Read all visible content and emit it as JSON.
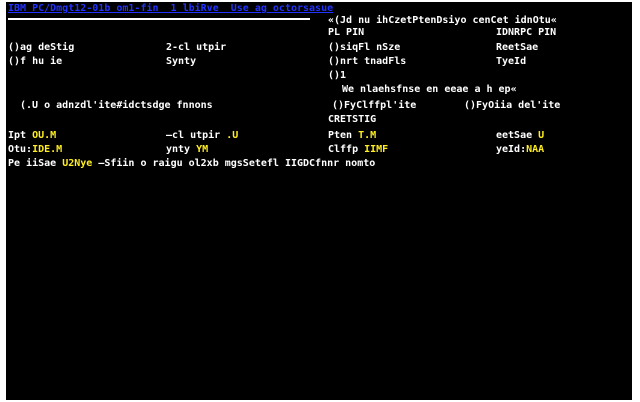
{
  "colors": {
    "background": "#000000",
    "text": "#ffffff",
    "title": "#2233ff",
    "value": "#ffee22"
  },
  "title_bar": "IBM PC/Dmgt12-01b om1-fin  1 lbiRve  Use ag octorsasue",
  "right_panel": {
    "heading": "«(Jd nu ihCzetPtenDsiyo cenCet idnOtu«",
    "line1_left": "PL PIN",
    "line1_right": "IDNRPC PIN",
    "row1_left": "()siqFl nSze",
    "row1_right": "ReetSae",
    "row2_left": "()nrt tnadFls",
    "row2_right": "TyeId",
    "row3_left": "()1",
    "message": "We nlaehsfnse en eeae a h ep«",
    "opt_left": "()FyClffpl'ite",
    "opt_right": "()FyOiia del'ite",
    "section": "CRETSTIG"
  },
  "left_panel": {
    "row1_left": "()ag deStig",
    "row1_right": "2-cl utpir",
    "row2_left": "()f hu ie",
    "row2_right": "Synty",
    "option_text": "(.U o adnzdl'ite#idctsdge fnnons"
  },
  "fields": {
    "ipt_label": "Ipt ",
    "ipt_value": "OU.M",
    "cl_label": "—cl utpir ",
    "cl_value": ".U",
    "ften_label": "Pten ",
    "ften_value": "T.M",
    "eet_label": "eetSae ",
    "eet_value": "U",
    "otu_label": "Otu:",
    "otu_value": "IDE.M",
    "ynty_label": "ynty ",
    "ynty_value": "YM",
    "clffp_label": "Clffp ",
    "clffp_value": "IIMF",
    "yeld_label": "yeId:",
    "yeld_value": "NAA"
  },
  "command_line": {
    "prefix": "Pe iiSae ",
    "highlight": "U2Nye",
    "rest": " —Sfiin o raigu ol2xb mgsSetefl IIGDCfnnr nomto"
  }
}
